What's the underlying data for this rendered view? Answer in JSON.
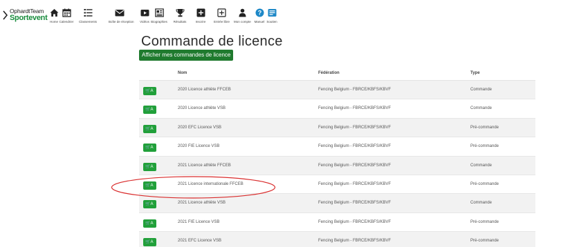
{
  "brand": {
    "name": "OphardtTeam",
    "sub": "Sportevent"
  },
  "nav": [
    {
      "label": "Home",
      "icon": "home-icon"
    },
    {
      "label": "Calendrier",
      "icon": "calendar-icon"
    },
    {
      "label": "Classements",
      "icon": "ranking-list-icon"
    },
    {
      "label": "Boîte de réception",
      "icon": "mail-icon"
    },
    {
      "label": "Vidéos",
      "icon": "video-icon"
    },
    {
      "label": "Biographies",
      "icon": "biography-icon"
    },
    {
      "label": "Résultats",
      "icon": "trophy-icon"
    },
    {
      "label": "Inscrire",
      "icon": "plus-square-icon"
    },
    {
      "label": "Entrée libre",
      "icon": "expand-square-icon"
    },
    {
      "label": "Mon compte",
      "icon": "user-icon"
    },
    {
      "label": "Manuel",
      "icon": "help-icon"
    },
    {
      "label": "Soutien",
      "icon": "support-icon"
    }
  ],
  "page": {
    "title": "Commande de licence",
    "my_orders_button": "Afficher mes commandes de licence"
  },
  "table": {
    "headers": {
      "nom": "Nom",
      "federation": "Fédération",
      "type": "Type"
    },
    "button_label": "A",
    "rows": [
      {
        "nom": "2020 Licence athlète FFCEB",
        "federation": "Fencing Belgium - FBRCE/KBFS/KBVF",
        "type": "Commande"
      },
      {
        "nom": "2020 Licence athlète VSB",
        "federation": "Fencing Belgium - FBRCE/KBFS/KBVF",
        "type": "Commande"
      },
      {
        "nom": "2020 EFC Licence VSB",
        "federation": "Fencing Belgium - FBRCE/KBFS/KBVF",
        "type": "Pré-commande"
      },
      {
        "nom": "2020 FIE Licence VSB",
        "federation": "Fencing Belgium - FBRCE/KBFS/KBVF",
        "type": "Pré-commande"
      },
      {
        "nom": "2021 Licence athlète FFCEB",
        "federation": "Fencing Belgium - FBRCE/KBFS/KBVF",
        "type": "Commande"
      },
      {
        "nom": "2021 Licence internationale FFCEB",
        "federation": "Fencing Belgium - FBRCE/KBFS/KBVF",
        "type": "Pré-commande"
      },
      {
        "nom": "2021 Licence athlète VSB",
        "federation": "Fencing Belgium - FBRCE/KBFS/KBVF",
        "type": "Commande"
      },
      {
        "nom": "2021 FIE Licence VSB",
        "federation": "Fencing Belgium - FBRCE/KBFS/KBVF",
        "type": "Pré-commande"
      },
      {
        "nom": "2021 EFC Licence VSB",
        "federation": "Fencing Belgium - FBRCE/KBFS/KBVF",
        "type": "Pré-commande"
      }
    ]
  },
  "colors": {
    "brand_green": "#198c3d",
    "button_green": "#21a03a",
    "dark_green": "#1f7a2e",
    "highlight_red": "#d92a2a",
    "help_blue": "#1e88c7"
  }
}
